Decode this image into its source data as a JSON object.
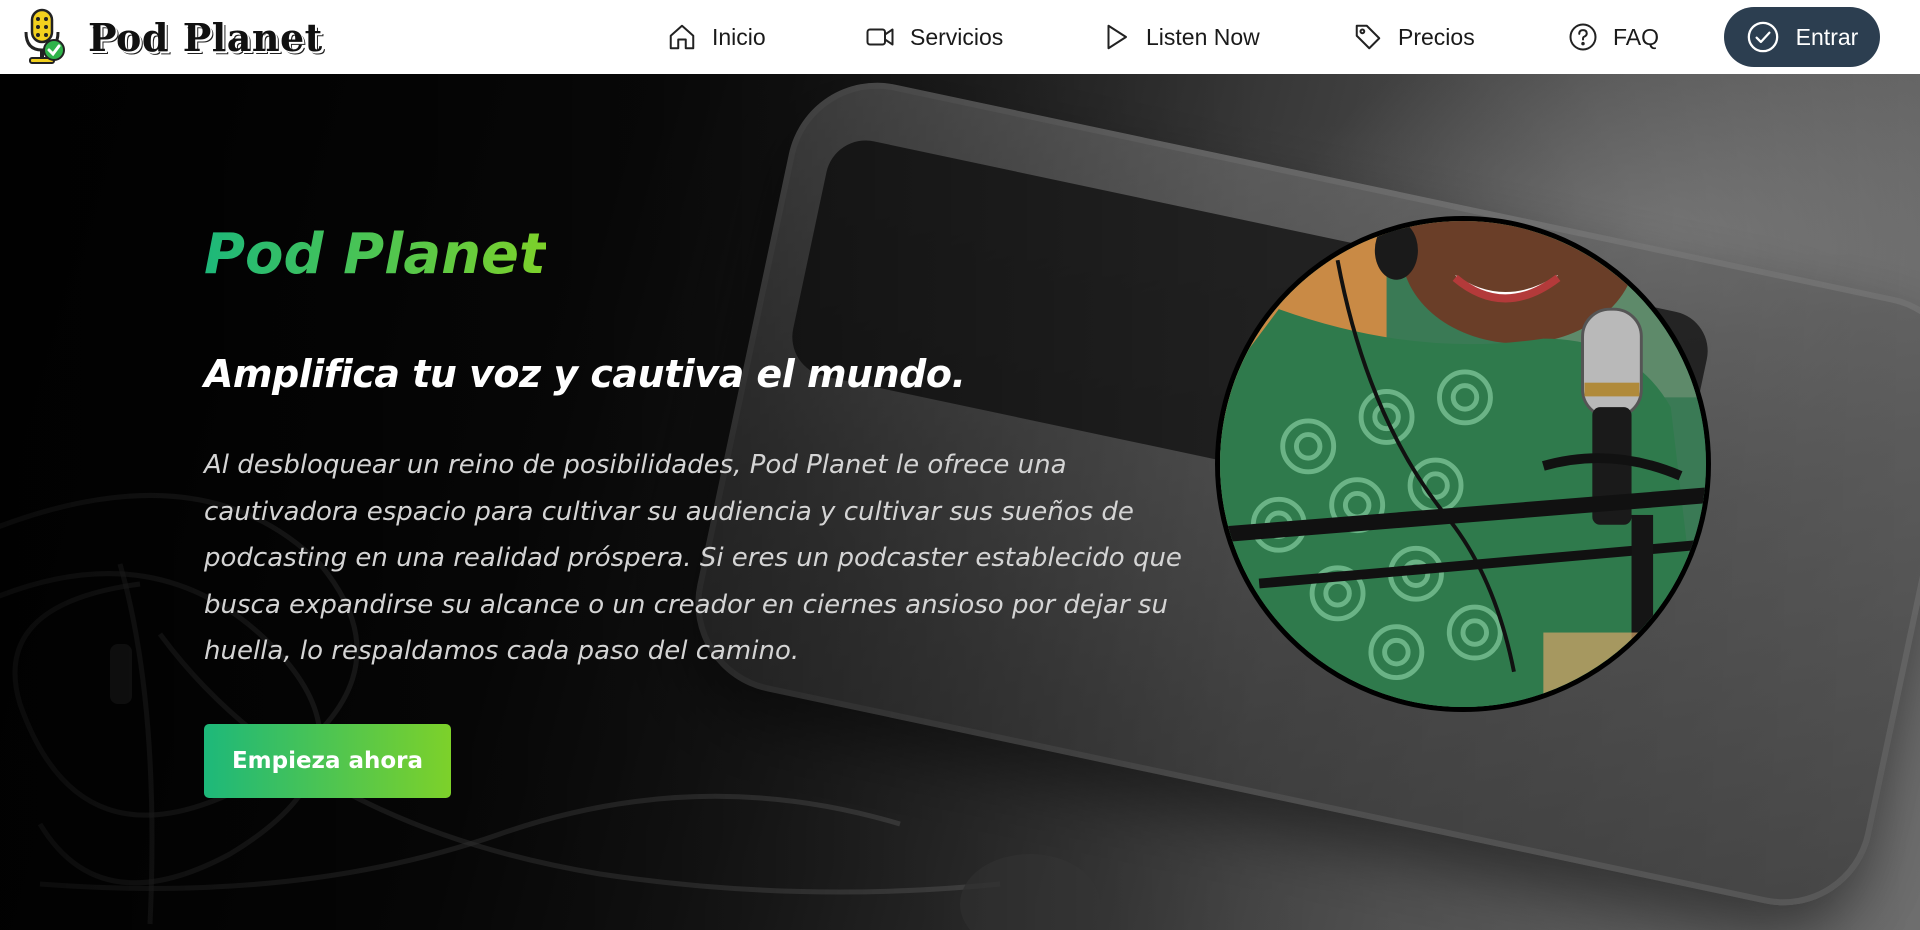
{
  "brand": {
    "name": "Pod Planet",
    "logo_icon": "microphone-check-logo"
  },
  "nav": {
    "items": [
      {
        "label": "Inicio",
        "icon": "home-icon"
      },
      {
        "label": "Servicios",
        "icon": "video-camera-icon"
      },
      {
        "label": "Listen Now",
        "icon": "play-icon"
      },
      {
        "label": "Precios",
        "icon": "price-tag-icon"
      },
      {
        "label": "FAQ",
        "icon": "question-circle-icon"
      }
    ],
    "login": {
      "label": "Entrar",
      "icon": "check-circle-icon"
    }
  },
  "hero": {
    "title": "Pod Planet",
    "subtitle": "Amplifica tu voz y cautiva el mundo.",
    "body": "Al desbloquear un reino de posibilidades, Pod Planet le ofrece una cautivadora espacio para cultivar su audiencia y cultivar sus sueños de podcasting en una realidad próspera. Si eres un podcaster establecido que busca expandirse su alcance o un creador en ciernes ansioso por dejar su huella, lo respaldamos cada paso del camino.",
    "cta": "Empieza ahora"
  },
  "colors": {
    "accent_gradient_start": "#1db87a",
    "accent_gradient_end": "#7dd12a",
    "login_button": "#2c3e50",
    "nav_background": "#ffffff"
  }
}
